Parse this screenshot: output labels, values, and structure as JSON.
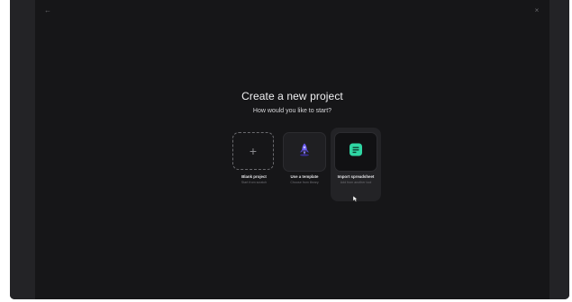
{
  "modal": {
    "title": "Create a new project",
    "subtitle": "How would you like to start?"
  },
  "header": {
    "back_icon": "←",
    "close_icon": "×"
  },
  "options": [
    {
      "label": "Blank project",
      "description": "Start from scratch",
      "icon": "plus-icon"
    },
    {
      "label": "Use a template",
      "description": "Choose from library",
      "icon": "rocket-icon"
    },
    {
      "label": "Import spreadsheet",
      "description": "Add from another tool",
      "icon": "spreadsheet-icon"
    }
  ],
  "colors": {
    "accent_green": "#2fd6a3",
    "accent_purple": "#6b5cf0"
  }
}
